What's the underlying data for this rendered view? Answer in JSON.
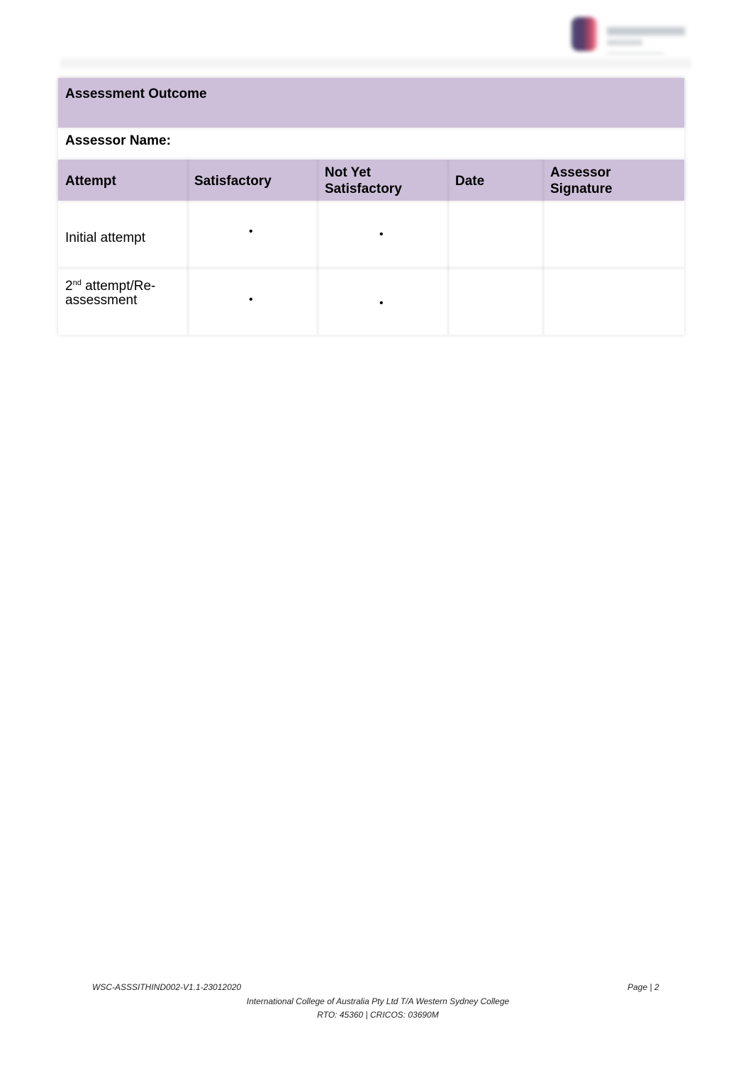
{
  "header": {
    "logo_text": "Western Sydney College"
  },
  "outcome_table": {
    "title": "Assessment Outcome",
    "assessor_name_label": "Assessor Name:",
    "columns": [
      "Attempt",
      "Satisfactory",
      "Not Yet Satisfactory",
      "Date",
      "Assessor Signature"
    ],
    "columns_lines": {
      "not_yet_1": "Not Yet",
      "not_yet_2": "Satisfactory",
      "sig_1": "Assessor",
      "sig_2": "Signature"
    },
    "rows": [
      {
        "attempt": "Initial attempt",
        "satisfactory": "•",
        "not_yet_satisfactory": "•",
        "date": "",
        "signature": ""
      },
      {
        "attempt_num": "2",
        "attempt_sup": "nd",
        "attempt_rest": " attempt/Re-",
        "attempt_line2": "assessment",
        "satisfactory": "•",
        "not_yet_satisfactory": "•",
        "date": "",
        "signature": ""
      }
    ],
    "accent_color": "#cdbfd9"
  },
  "footer": {
    "doc_code": "WSC-ASSSITHIND002-V1.1-23012020",
    "page_label": "Page",
    "page_number": "2",
    "org_line": "International College of Australia Pty Ltd T/A Western Sydney College",
    "rto_line": "RTO: 45360",
    "cricos_line": "CRICOS: 03690M"
  }
}
